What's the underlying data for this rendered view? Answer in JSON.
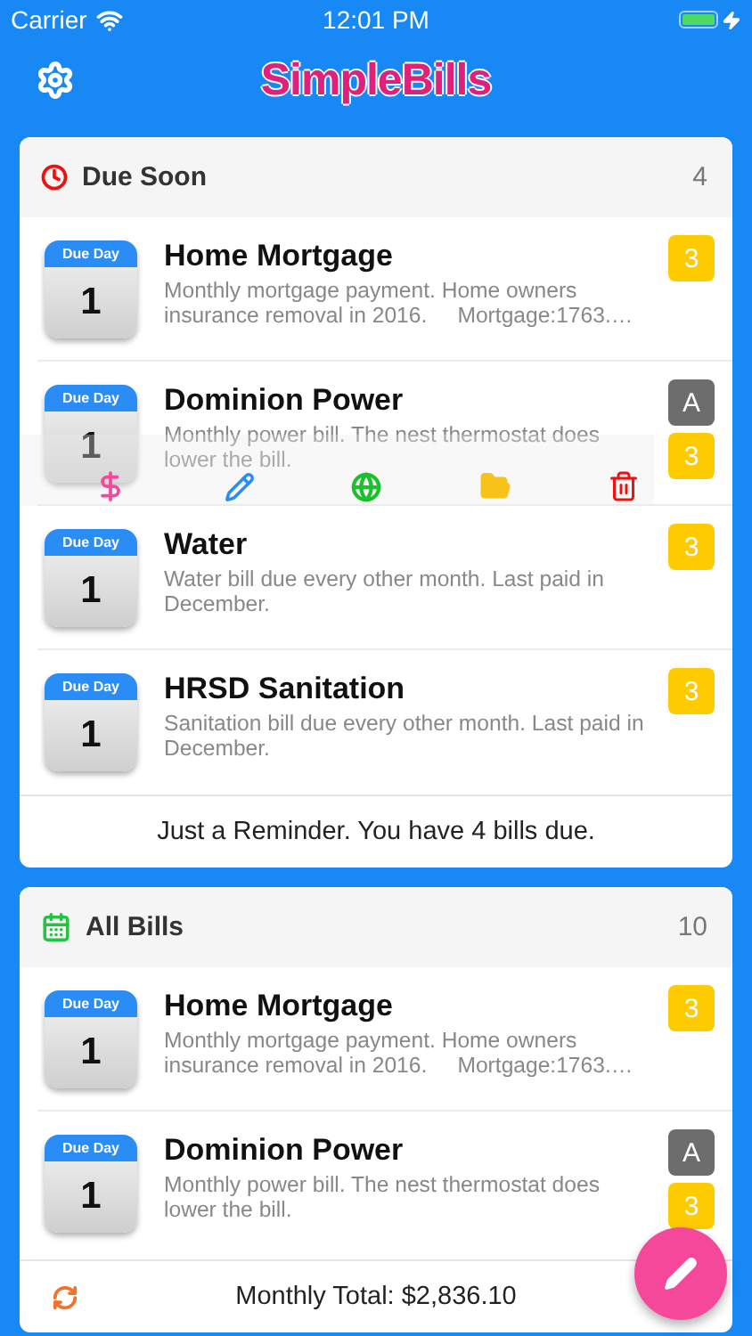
{
  "status_bar": {
    "carrier": "Carrier",
    "time": "12:01 PM"
  },
  "app_bar": {
    "title": "SimpleBills"
  },
  "sections": [
    {
      "kind": "due_soon",
      "title": "Due Soon",
      "count": "4",
      "bills": [
        {
          "due_label": "Due Day",
          "day": "1",
          "name": "Home Mortgage",
          "description": "Monthly mortgage payment. Home owners insurance removal in 2016.     Mortgage:1763.…",
          "badges": [
            {
              "text": "3",
              "color": "#fecb00"
            }
          ],
          "actions_open": false
        },
        {
          "due_label": "Due Day",
          "day": "1",
          "name": "Dominion Power",
          "description": "Monthly power bill. The nest thermostat does lower the bill.",
          "badges": [
            {
              "text": "A",
              "color": "#6d6d6d"
            },
            {
              "text": "3",
              "color": "#fecb00"
            }
          ],
          "actions_open": true
        },
        {
          "due_label": "Due Day",
          "day": "1",
          "name": "Water",
          "description": "Water bill due every other month. Last paid in December.",
          "badges": [
            {
              "text": "3",
              "color": "#fecb00"
            }
          ],
          "actions_open": false
        },
        {
          "due_label": "Due Day",
          "day": "1",
          "name": "HRSD Sanitation",
          "description": "Sanitation bill due every other month. Last paid in December.",
          "badges": [
            {
              "text": "3",
              "color": "#fecb00"
            }
          ],
          "actions_open": false
        }
      ],
      "footer": {
        "kind": "message",
        "text": "Just a Reminder. You have 4 bills due."
      }
    },
    {
      "kind": "all_bills",
      "title": "All Bills",
      "count": "10",
      "bills": [
        {
          "due_label": "Due Day",
          "day": "1",
          "name": "Home Mortgage",
          "description": "Monthly mortgage payment. Home owners insurance removal in 2016.     Mortgage:1763.…",
          "badges": [
            {
              "text": "3",
              "color": "#fecb00"
            }
          ],
          "actions_open": false
        },
        {
          "due_label": "Due Day",
          "day": "1",
          "name": "Dominion Power",
          "description": "Monthly power bill. The nest thermostat does lower the bill.",
          "badges": [
            {
              "text": "A",
              "color": "#6d6d6d"
            },
            {
              "text": "3",
              "color": "#fecb00"
            }
          ],
          "actions_open": false
        }
      ],
      "footer": {
        "kind": "total",
        "text": "Monthly Total: $2,836.10"
      }
    }
  ]
}
